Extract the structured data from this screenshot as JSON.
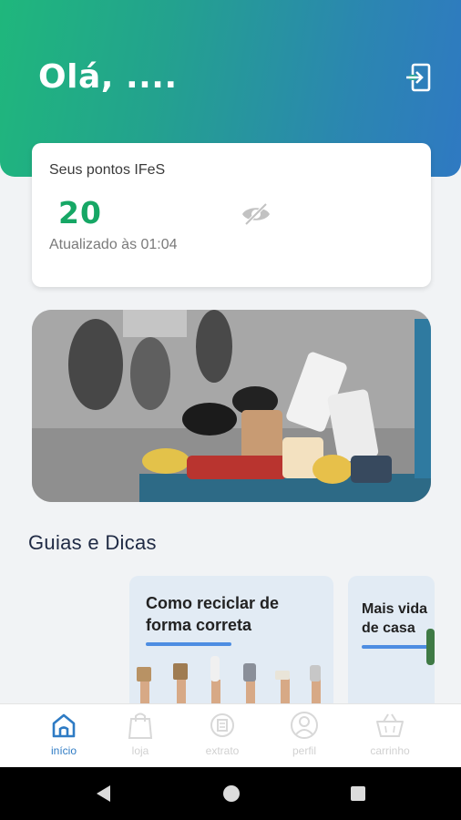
{
  "header": {
    "greeting": "Olá, ....",
    "logout_icon": "logout-icon",
    "gradient_start": "#1fb77c",
    "gradient_end": "#2f79c2"
  },
  "points_card": {
    "title": "Seus pontos IFeS",
    "points": "20",
    "updated": "Atualizado às 01:04",
    "visibility_icon": "eye-off-icon",
    "points_color": "#16a765"
  },
  "banner": {
    "image": "recycling-bin-with-coffee-cups-photo"
  },
  "guides": {
    "section_title": "Guias e Dicas",
    "cards": [
      {
        "title": "Como reciclar de\nforma correta"
      },
      {
        "title": "Mais vida\nde casa"
      }
    ]
  },
  "bottom_nav": {
    "active_color": "#2e7bc4",
    "items": [
      {
        "label": "início",
        "icon": "home-icon",
        "active": true
      },
      {
        "label": "loja",
        "icon": "shopping-bag-icon",
        "active": false
      },
      {
        "label": "extrato",
        "icon": "receipt-icon",
        "active": false
      },
      {
        "label": "perfil",
        "icon": "user-icon",
        "active": false
      },
      {
        "label": "carrinho",
        "icon": "basket-icon",
        "active": false
      }
    ]
  },
  "system_nav": {
    "back_icon": "back-icon",
    "home_icon": "home-circle-icon",
    "recents_icon": "recents-icon"
  }
}
